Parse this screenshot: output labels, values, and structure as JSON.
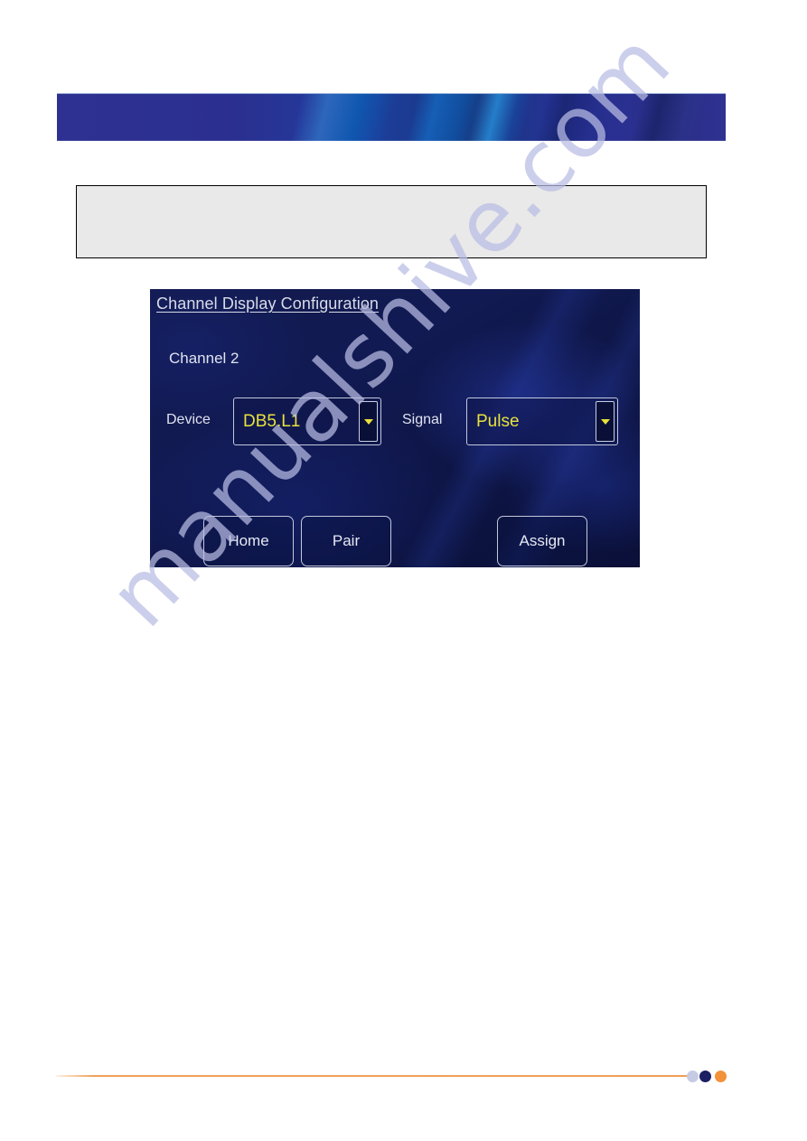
{
  "header": {
    "banner_primary_color": "#2e3191",
    "banner_accent_color": "#1072c8"
  },
  "note_box": {
    "text": "",
    "background_color": "#e9e9e9",
    "border_color": "#000000"
  },
  "touch_panel": {
    "title": "Channel Display Configuration",
    "channel_label": "Channel 2",
    "background_color": "#111a52",
    "value_color": "#e8e13c",
    "text_color": "#dfe2ee",
    "fields": [
      {
        "label": "Device",
        "value": "DB5.L1",
        "arrow_icon": "chevron-down-icon"
      },
      {
        "label": "Signal",
        "value": "Pulse",
        "arrow_icon": "chevron-down-icon"
      }
    ],
    "buttons": [
      {
        "label": "Home"
      },
      {
        "label": "Pair"
      },
      {
        "label": "Assign"
      }
    ]
  },
  "watermark": {
    "text": "manualshive.com",
    "color": "#b9bde4"
  },
  "footer": {
    "rule_color": "#ef9f57",
    "dots": [
      {
        "name": "dot-light",
        "color": "#c5cbe3"
      },
      {
        "name": "dot-navy",
        "color": "#1b1f63"
      },
      {
        "name": "dot-orange",
        "color": "#f2923a"
      }
    ]
  }
}
